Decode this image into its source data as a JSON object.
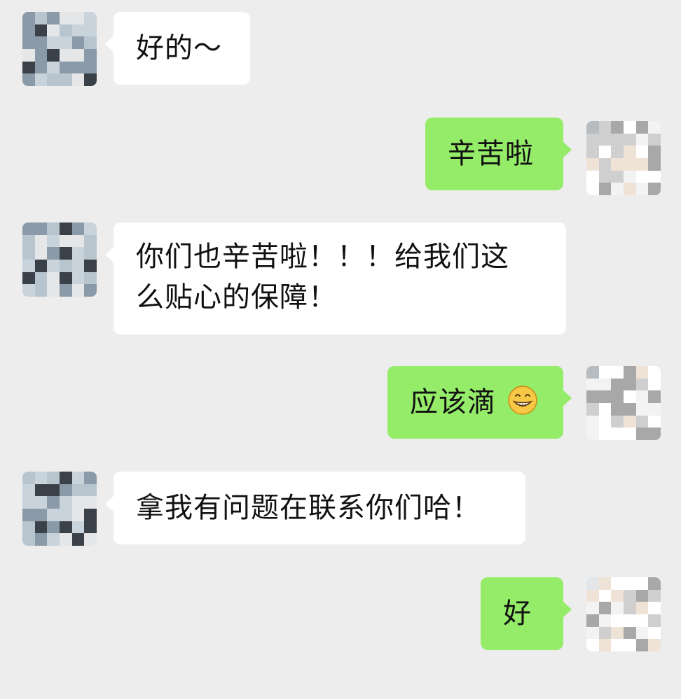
{
  "chat": {
    "messages": [
      {
        "side": "left",
        "text": "好的～"
      },
      {
        "side": "right",
        "text": "辛苦啦"
      },
      {
        "side": "left",
        "line1": "你们也辛苦啦！！！给我们这",
        "line2": "么贴心的保障！"
      },
      {
        "side": "right",
        "text": "应该滴",
        "emoji": "grinning-face-emoji"
      },
      {
        "side": "left",
        "text": "拿我有问题在联系你们哈！"
      },
      {
        "side": "right",
        "text": "好"
      }
    ]
  },
  "colors": {
    "background": "#ededed",
    "incoming_bubble": "#ffffff",
    "outgoing_bubble": "#95ec69",
    "text": "#111111"
  }
}
